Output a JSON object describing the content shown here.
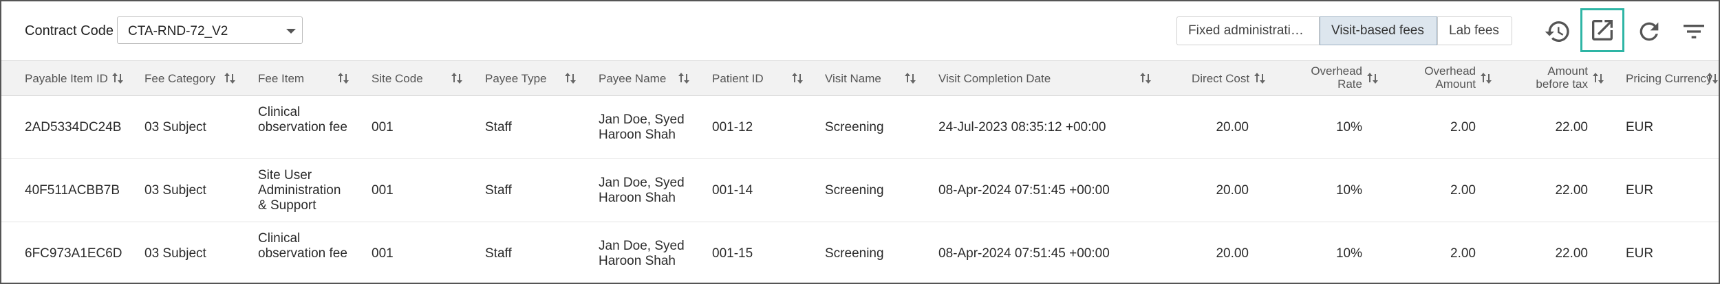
{
  "toolbar": {
    "contract_code_label": "Contract Code",
    "contract_code_value": "CTA-RND-72_V2",
    "tabs": [
      {
        "label": "Fixed administrati…",
        "selected": false
      },
      {
        "label": "Visit-based fees",
        "selected": true
      },
      {
        "label": "Lab fees",
        "selected": false
      }
    ],
    "icons": [
      "history-icon",
      "open-in-new-icon",
      "refresh-icon",
      "filter-icon"
    ]
  },
  "table": {
    "columns": [
      "Payable Item ID",
      "Fee Category",
      "Fee Item",
      "Site Code",
      "Payee Type",
      "Payee Name",
      "Patient ID",
      "Visit Name",
      "Visit Completion Date",
      "Direct Cost",
      "Overhead Rate",
      "Overhead Amount",
      "Amount before tax",
      "Pricing Currency"
    ],
    "rows": [
      {
        "payable_item_id": "2AD5334DC24B",
        "fee_category": "03 Subject",
        "fee_item": "Clinical observation fee",
        "site_code": "001",
        "payee_type": "Staff",
        "payee_name": "Jan Doe, Syed Haroon Shah",
        "patient_id": "001-12",
        "visit_name": "Screening",
        "visit_completion_date": "24-Jul-2023 08:35:12 +00:00",
        "direct_cost": "20.00",
        "overhead_rate": "10%",
        "overhead_amount": "2.00",
        "amount_before_tax": "22.00",
        "pricing_currency": "EUR"
      },
      {
        "payable_item_id": "40F511ACBB7B",
        "fee_category": "03 Subject",
        "fee_item": "Site User Administration & Support",
        "site_code": "001",
        "payee_type": "Staff",
        "payee_name": "Jan Doe, Syed Haroon Shah",
        "patient_id": "001-14",
        "visit_name": "Screening",
        "visit_completion_date": "08-Apr-2024 07:51:45 +00:00",
        "direct_cost": "20.00",
        "overhead_rate": "10%",
        "overhead_amount": "2.00",
        "amount_before_tax": "22.00",
        "pricing_currency": "EUR"
      },
      {
        "payable_item_id": "6FC973A1EC6D",
        "fee_category": "03 Subject",
        "fee_item": "Clinical observation fee",
        "site_code": "001",
        "payee_type": "Staff",
        "payee_name": "Jan Doe, Syed Haroon Shah",
        "patient_id": "001-15",
        "visit_name": "Screening",
        "visit_completion_date": "08-Apr-2024 07:51:45 +00:00",
        "direct_cost": "20.00",
        "overhead_rate": "10%",
        "overhead_amount": "2.00",
        "amount_before_tax": "22.00",
        "pricing_currency": "EUR"
      }
    ]
  },
  "colors": {
    "selected_tab_bg": "#dde6ee",
    "highlight_border": "#2eb5a5",
    "header_bg": "#f2f2f2"
  }
}
